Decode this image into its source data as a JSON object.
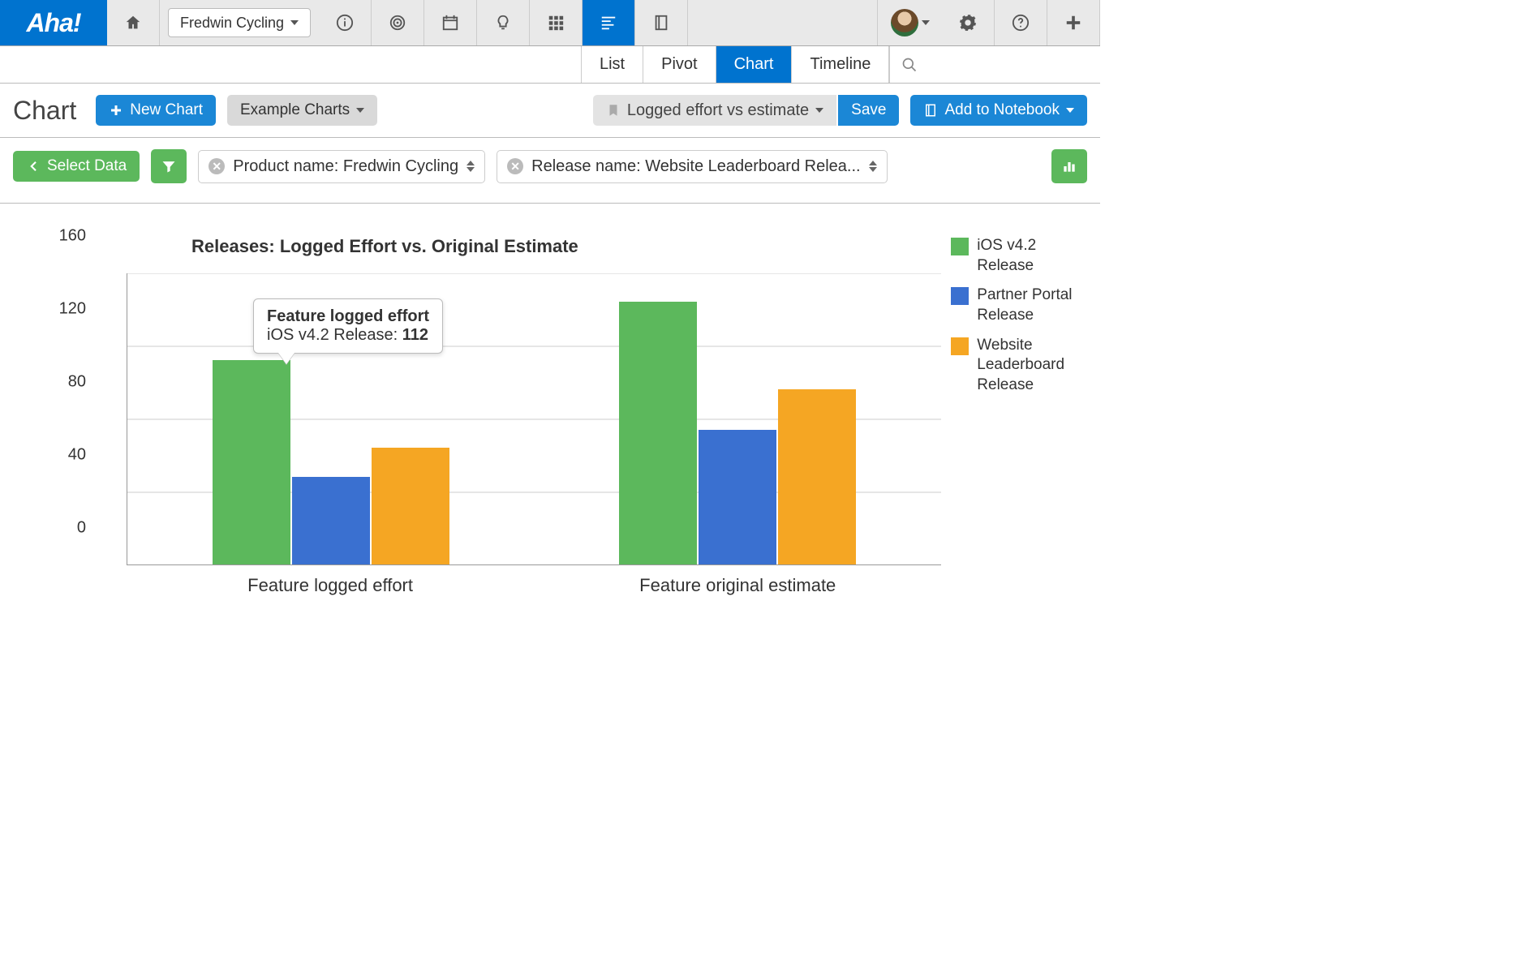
{
  "logo_text": "Aha!",
  "product_selector": "Fredwin Cycling",
  "subtabs": {
    "list": "List",
    "pivot": "Pivot",
    "chart": "Chart",
    "timeline": "Timeline"
  },
  "page": {
    "title": "Chart",
    "new_chart": "New Chart",
    "example_charts": "Example Charts",
    "saved_name": "Logged effort vs estimate",
    "save": "Save",
    "add_to_notebook": "Add to Notebook"
  },
  "filters": {
    "select_data": "Select Data",
    "product_filter": "Product name: Fredwin Cycling",
    "release_filter": "Release name: Website Leaderboard Relea..."
  },
  "tooltip": {
    "title": "Feature logged effort",
    "series": "iOS v4.2 Release:",
    "value": "112"
  },
  "chart_data": {
    "type": "bar",
    "title": "Releases: Logged Effort vs. Original Estimate",
    "categories": [
      "Feature logged effort",
      "Feature original estimate"
    ],
    "series": [
      {
        "name": "iOS v4.2 Release",
        "color": "#5cb85c",
        "values": [
          112,
          144
        ]
      },
      {
        "name": "Partner Portal Release",
        "color": "#3a70d0",
        "values": [
          48,
          74
        ]
      },
      {
        "name": "Website Leaderboard Release",
        "color": "#f5a623",
        "values": [
          64,
          96
        ]
      }
    ],
    "ylim": [
      0,
      160
    ],
    "yticks": [
      0,
      40,
      80,
      120,
      160
    ]
  }
}
